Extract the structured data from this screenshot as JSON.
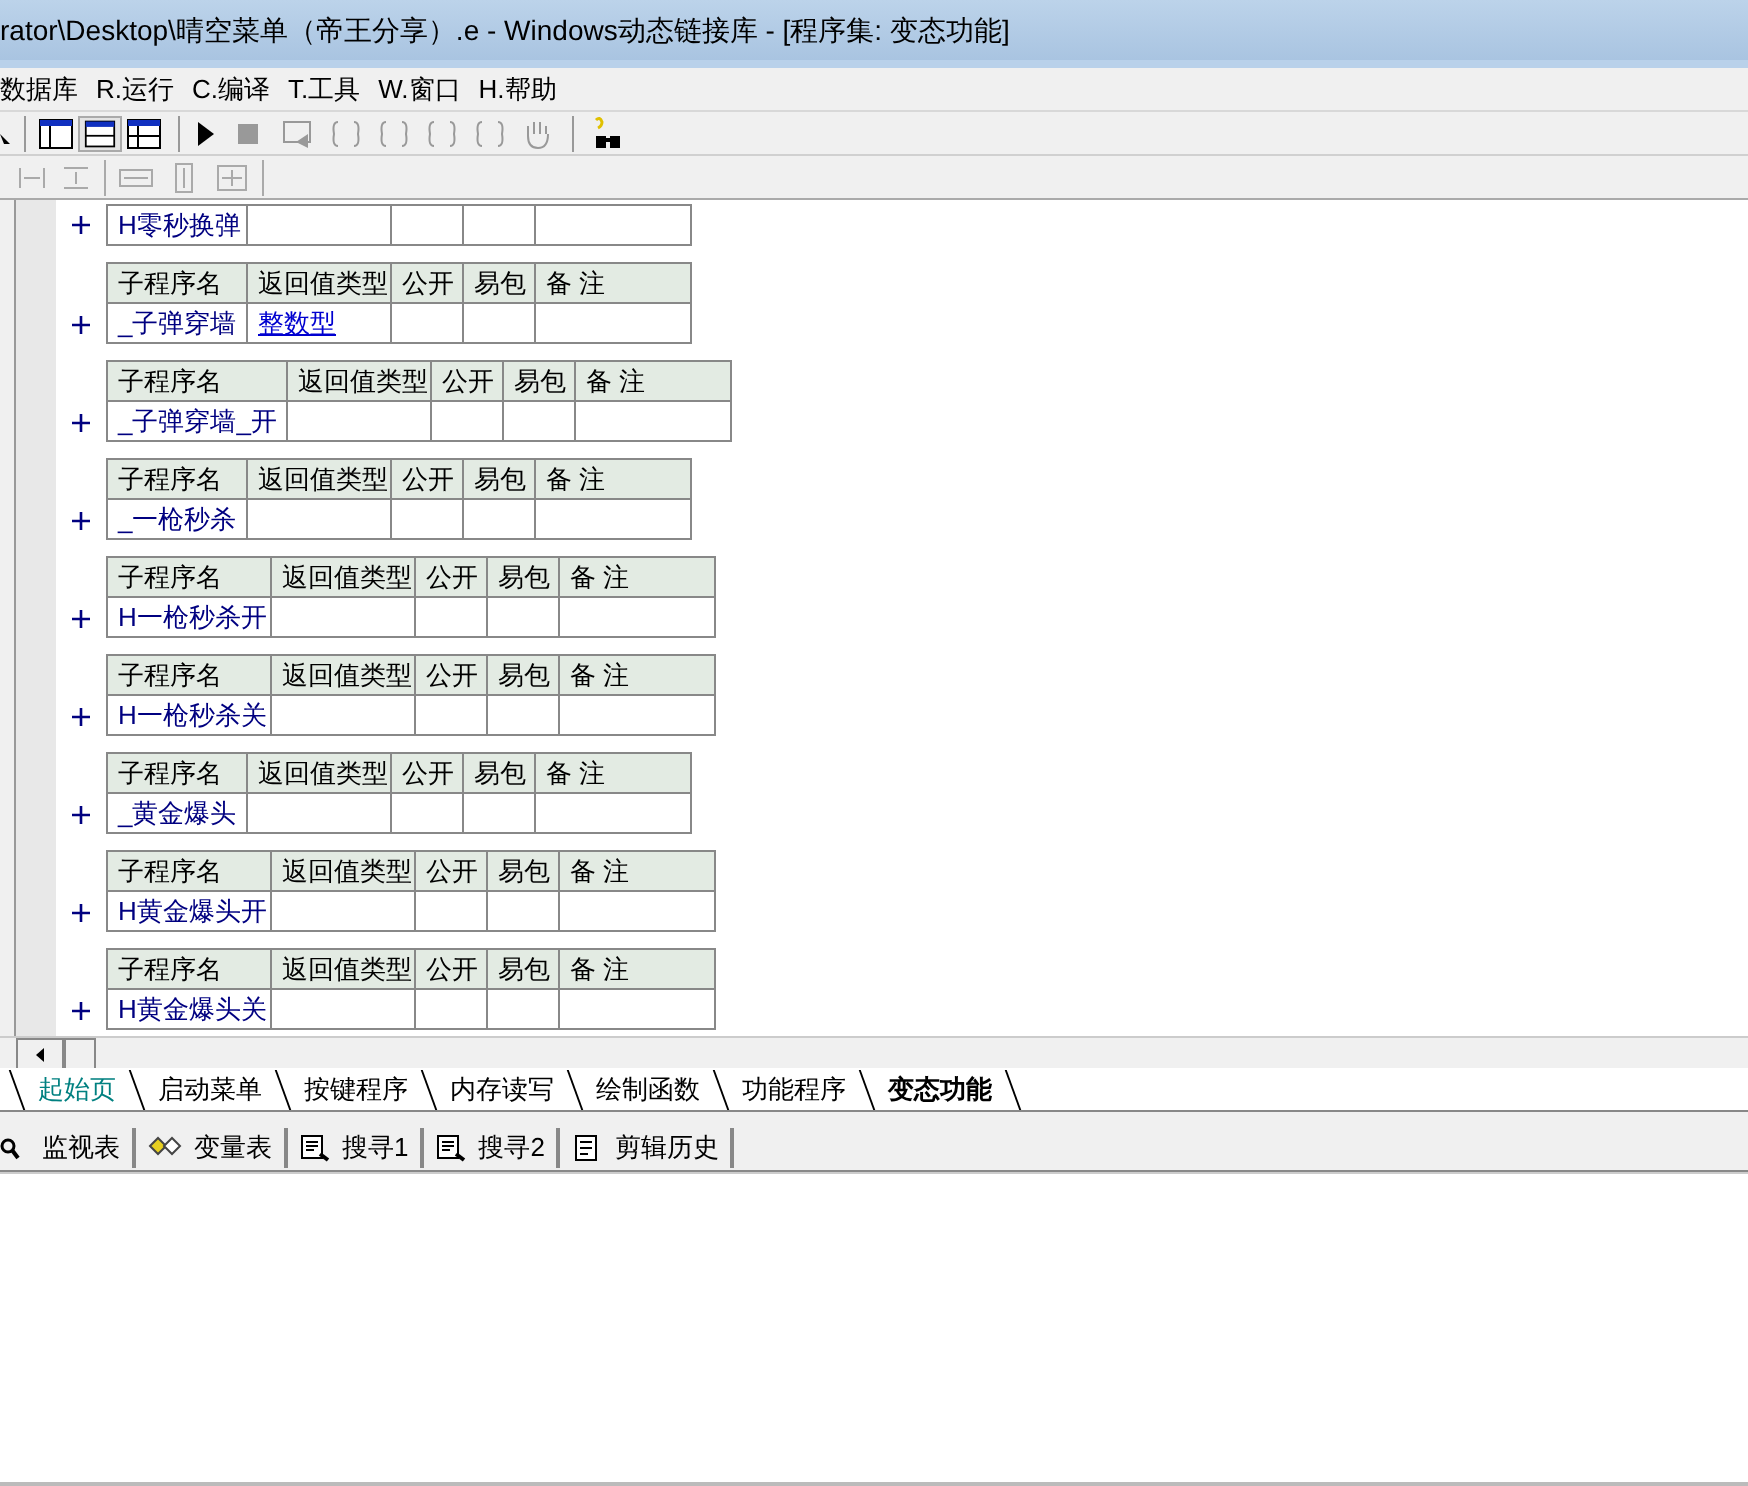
{
  "window": {
    "title": "rator\\Desktop\\晴空菜单（帝王分享）.e - Windows动态链接库 - [程序集: 变态功能]"
  },
  "menu": [
    "数据库",
    "R.运行",
    "C.编译",
    "T.工具",
    "W.窗口",
    "H.帮助"
  ],
  "blocks": [
    {
      "name": "H零秒换弹"
    },
    {
      "columns": [
        "子程序名",
        "返回值类型",
        "公开",
        "易包",
        "备 注"
      ],
      "name": "_子弹穿墙",
      "return_type": "整数型"
    },
    {
      "columns": [
        "子程序名",
        "返回值类型",
        "公开",
        "易包",
        "备 注"
      ],
      "name": "_子弹穿墙_开"
    },
    {
      "columns": [
        "子程序名",
        "返回值类型",
        "公开",
        "易包",
        "备 注"
      ],
      "name": "_一枪秒杀"
    },
    {
      "columns": [
        "子程序名",
        "返回值类型",
        "公开",
        "易包",
        "备 注"
      ],
      "name": "H一枪秒杀开"
    },
    {
      "columns": [
        "子程序名",
        "返回值类型",
        "公开",
        "易包",
        "备 注"
      ],
      "name": "H一枪秒杀关"
    },
    {
      "columns": [
        "子程序名",
        "返回值类型",
        "公开",
        "易包",
        "备 注"
      ],
      "name": "_黄金爆头"
    },
    {
      "columns": [
        "子程序名",
        "返回值类型",
        "公开",
        "易包",
        "备 注"
      ],
      "name": "H黄金爆头开"
    },
    {
      "columns": [
        "子程序名",
        "返回值类型",
        "公开",
        "易包",
        "备 注"
      ],
      "name": "H黄金爆头关"
    }
  ],
  "tabs": [
    {
      "label": "起始页",
      "selected": false,
      "kind": "start"
    },
    {
      "label": "启动菜单",
      "selected": false
    },
    {
      "label": "按键程序",
      "selected": false
    },
    {
      "label": "内存读写",
      "selected": false
    },
    {
      "label": "绘制函数",
      "selected": false
    },
    {
      "label": "功能程序",
      "selected": false
    },
    {
      "label": "变态功能",
      "selected": true
    }
  ],
  "panel_tabs": [
    {
      "label": "监视表",
      "kind": "watch"
    },
    {
      "label": "变量表",
      "kind": "vars"
    },
    {
      "label": "搜寻1",
      "kind": "search"
    },
    {
      "label": "搜寻2",
      "kind": "search"
    },
    {
      "label": "剪辑历史",
      "kind": "clip"
    }
  ]
}
